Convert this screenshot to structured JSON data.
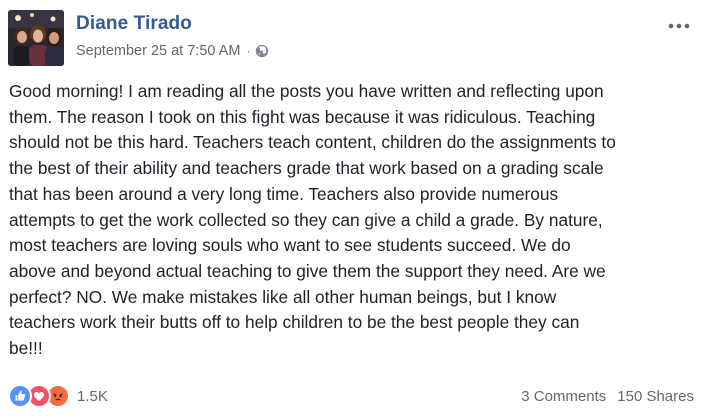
{
  "post": {
    "author": "Diane Tirado",
    "timestamp": "September 25 at 7:50 AM",
    "separator": "·",
    "privacy_icon": "globe-icon",
    "menu_icon": "more-options-icon",
    "text": "Good morning! I am reading all the posts you have written and reflecting upon\nthem. The reason I took on this fight was because it was ridiculous. Teaching\nshould not be this hard. Teachers teach content, children do the assignments to\nthe best of their ability and teachers grade that work based on a grading scale\nthat has been around a very long time. Teachers also provide numerous\nattempts to get the work collected so they can give a child a grade. By nature,\nmost teachers are loving souls who want to see students succeed. We do\nabove and beyond actual teaching to give them the support they need. Are we\nperfect? NO. We make mistakes like all other human beings, but I know\nteachers work their butts off to help children to be the best people they can\nbe!!!"
  },
  "footer": {
    "reactions": [
      {
        "name": "like",
        "icon": "like-reaction-icon",
        "color": "#5890ff"
      },
      {
        "name": "love",
        "icon": "love-reaction-icon",
        "color": "#f25268"
      },
      {
        "name": "angry",
        "icon": "angry-reaction-icon",
        "color": "#f7714b"
      }
    ],
    "reaction_count": "1.5K",
    "comments": "3 Comments",
    "shares": "150 Shares"
  },
  "colors": {
    "author_link": "#365899",
    "meta_text": "#616770",
    "body_text": "#1d2129"
  }
}
